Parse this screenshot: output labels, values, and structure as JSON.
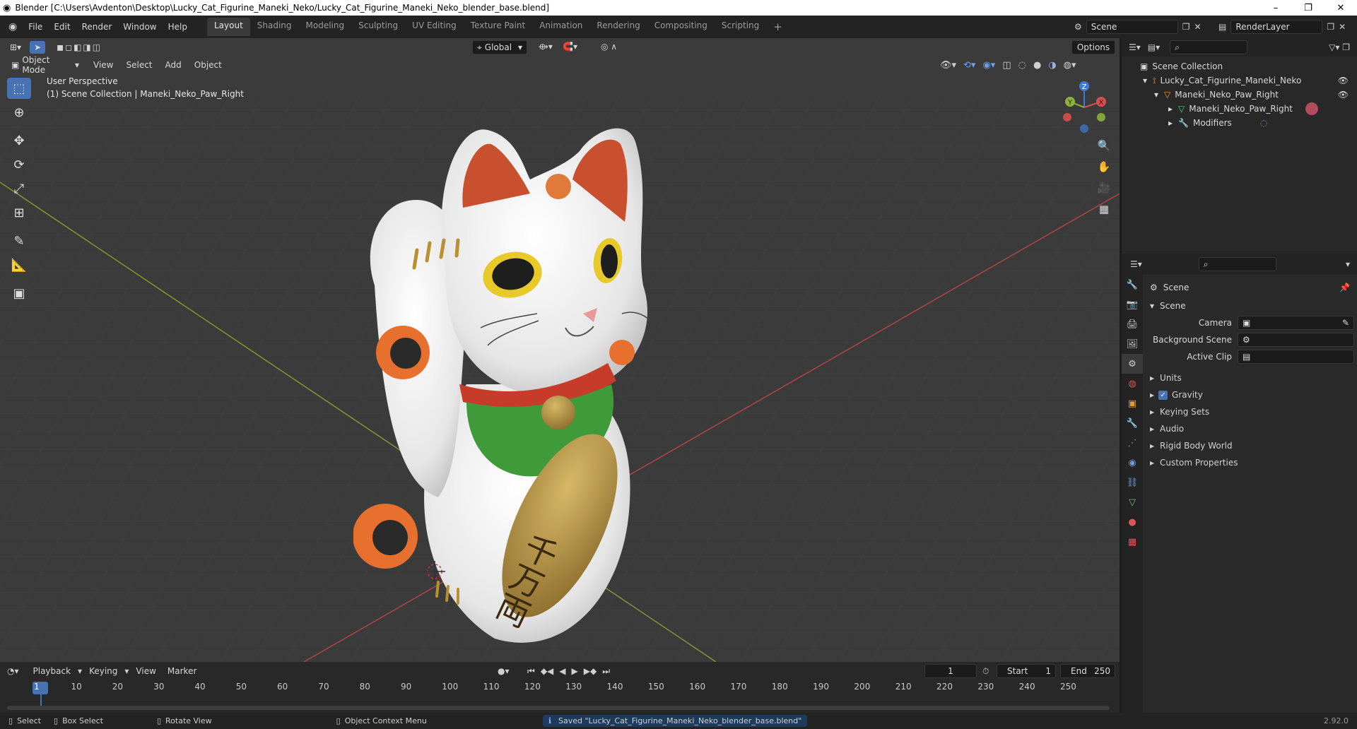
{
  "window": {
    "title": "Blender [C:\\Users\\Avdenton\\Desktop\\Lucky_Cat_Figurine_Maneki_Neko/Lucky_Cat_Figurine_Maneki_Neko_blender_base.blend]",
    "minimize": "–",
    "maximize": "❐",
    "close": "✕"
  },
  "menu": [
    "File",
    "Edit",
    "Render",
    "Window",
    "Help"
  ],
  "workspaces": [
    "Layout",
    "Shading",
    "Modeling",
    "Sculpting",
    "UV Editing",
    "Texture Paint",
    "Animation",
    "Rendering",
    "Compositing",
    "Scripting"
  ],
  "active_workspace": "Layout",
  "scene_field": "Scene",
  "render_layer_field": "RenderLayer",
  "viewport": {
    "orientation": "Global",
    "options_label": "Options",
    "mode": "Object Mode",
    "header_menu": [
      "View",
      "Select",
      "Add",
      "Object"
    ],
    "perspective_label": "User Perspective",
    "collection_label": "(1) Scene Collection | Maneki_Neko_Paw_Right",
    "gizmo": {
      "x": "X",
      "y": "Y",
      "z": "Z"
    },
    "coin_text": "千万両"
  },
  "outliner": {
    "root": "Scene Collection",
    "rows": [
      {
        "label": "Lucky_Cat_Figurine_Maneki_Neko",
        "icon": "armature-icon"
      },
      {
        "label": "Maneki_Neko_Paw_Right",
        "icon": "object-icon"
      },
      {
        "label": "Maneki_Neko_Paw_Right",
        "icon": "mesh-icon"
      },
      {
        "label": "Modifiers",
        "icon": "wrench-icon"
      }
    ]
  },
  "properties": {
    "context": "Scene",
    "panel_title": "Scene",
    "camera_label": "Camera",
    "background_scene_label": "Background Scene",
    "active_clip_label": "Active Clip",
    "subpanels": [
      "Units",
      "Gravity",
      "Keying Sets",
      "Audio",
      "Rigid Body World",
      "Custom Properties"
    ],
    "gravity_checked": true
  },
  "timeline": {
    "menu": [
      "Playback",
      "Keying",
      "View",
      "Marker"
    ],
    "current_frame": "1",
    "start_label": "Start",
    "start_value": "1",
    "end_label": "End",
    "end_value": "250",
    "ticks": [
      "1",
      "10",
      "20",
      "30",
      "40",
      "50",
      "60",
      "70",
      "80",
      "90",
      "100",
      "110",
      "120",
      "130",
      "140",
      "150",
      "160",
      "170",
      "180",
      "190",
      "200",
      "210",
      "220",
      "230",
      "240",
      "250"
    ]
  },
  "status": {
    "select": "Select",
    "box_select": "Box Select",
    "rotate_view": "Rotate View",
    "context_menu": "Object Context Menu",
    "message": "Saved \"Lucky_Cat_Figurine_Maneki_Neko_blender_base.blend\"",
    "version": "2.92.0"
  },
  "colors": {
    "accent": "#4772b3",
    "bg_viewport": "#3b3b3b",
    "x_axis": "#d94f4f",
    "y_axis": "#8ab33a",
    "z_axis": "#3f7bd6"
  }
}
